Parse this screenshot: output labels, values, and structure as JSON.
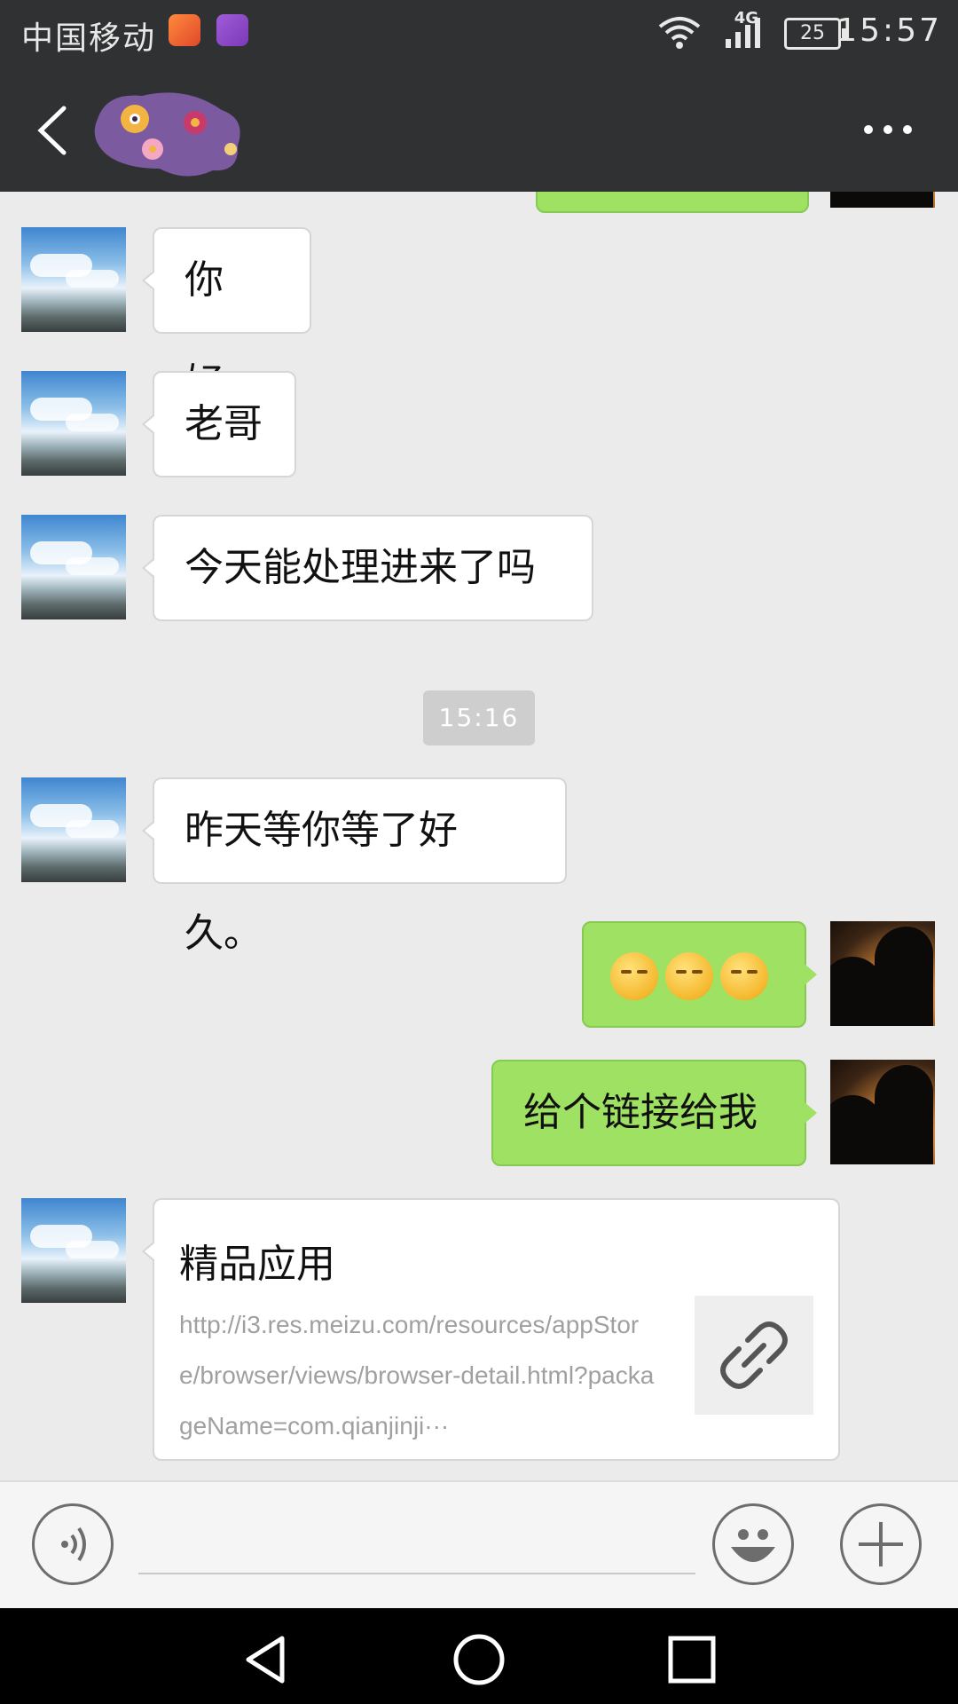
{
  "status_bar": {
    "carrier": "中国移动",
    "network": "4G",
    "battery": "25",
    "time": "15:57"
  },
  "header": {
    "back_icon": "chevron-left-icon",
    "more_icon": "more-horizontal-icon"
  },
  "messages": [
    {
      "side": "left",
      "text": "你好。"
    },
    {
      "side": "left",
      "text": "老哥"
    },
    {
      "side": "left",
      "text": "今天能处理进来了吗"
    },
    {
      "side": "left",
      "text": "昨天等你等了好久。"
    },
    {
      "side": "right",
      "emoji_count": 3,
      "emoji": "smirk-sweat-emoji"
    },
    {
      "side": "right",
      "text": "给个链接给我"
    }
  ],
  "timestamp": "15:16",
  "link_card": {
    "title": "精品应用",
    "url": "http://i3.res.meizu.com/resources/appStore/browser/views/browser-detail.html?packageName=com.qianjinji···",
    "icon": "link-icon"
  },
  "input_bar": {
    "voice_icon": "voice-icon",
    "emoji_icon": "smiley-icon",
    "plus_icon": "plus-icon",
    "text_value": ""
  },
  "nav_bar": {
    "back_icon": "triangle-back-icon",
    "home_icon": "circle-home-icon",
    "recents_icon": "square-recents-icon"
  }
}
